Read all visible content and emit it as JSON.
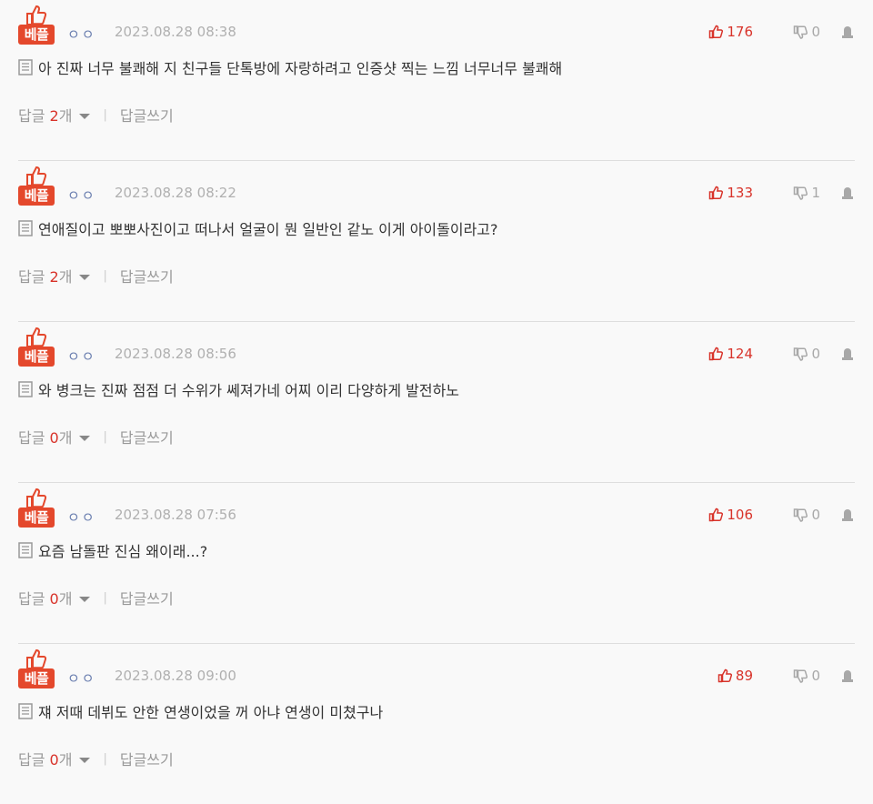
{
  "labels": {
    "badge": "베플",
    "user": "ㅇㅇ",
    "reply_prefix": "답글",
    "reply_suffix": "개",
    "write_reply": "답글쓰기"
  },
  "colors": {
    "accent_red": "#e4482c",
    "like_red": "#d8332a",
    "muted": "#999999"
  },
  "icons": {
    "best": "thumbs-up-icon",
    "like": "thumbs-up-icon",
    "dislike": "thumbs-down-icon",
    "report": "report-icon",
    "memo": "memo-icon"
  },
  "comments": [
    {
      "date": "2023.08.28 08:38",
      "likes": "176",
      "dislikes": "0",
      "text": "아 진짜 너무 불쾌해 지 친구들 단톡방에 자랑하려고 인증샷 찍는 느낌 너무너무 불쾌해",
      "replies": "2"
    },
    {
      "date": "2023.08.28 08:22",
      "likes": "133",
      "dislikes": "1",
      "text": "연애질이고 뽀뽀사진이고 떠나서 얼굴이 뭔 일반인 같노 이게 아이돌이라고?",
      "replies": "2"
    },
    {
      "date": "2023.08.28 08:56",
      "likes": "124",
      "dislikes": "0",
      "text": "와 병크는 진짜 점점 더 수위가 쎄져가네 어찌 이리 다양하게 발전하노",
      "replies": "0"
    },
    {
      "date": "2023.08.28 07:56",
      "likes": "106",
      "dislikes": "0",
      "text": "요즘 남돌판 진심 왜이래...?",
      "replies": "0"
    },
    {
      "date": "2023.08.28 09:00",
      "likes": "89",
      "dislikes": "0",
      "text": "쟤 저때 데뷔도 안한 연생이었을 꺼 아냐 연생이 미쳤구나",
      "replies": "0"
    }
  ]
}
